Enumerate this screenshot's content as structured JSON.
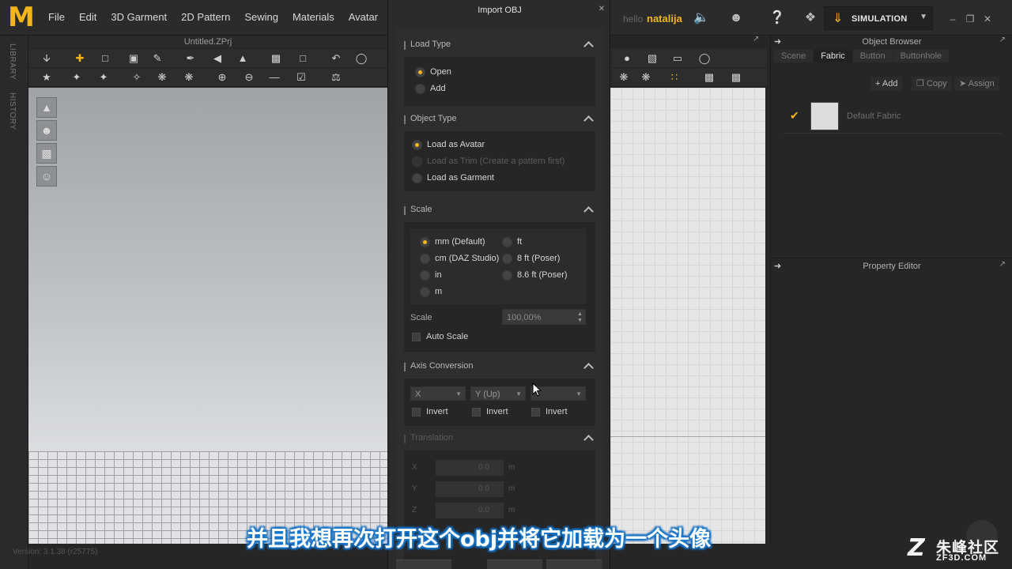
{
  "app": {
    "logo": "M",
    "menu": [
      "File",
      "Edit",
      "3D Garment",
      "2D Pattern",
      "Sewing",
      "Materials",
      "Avatar"
    ],
    "hello": "hello",
    "username": "natalija",
    "simulation_label": "SIMULATION",
    "accent_color": "#f2b61c"
  },
  "left_tabs": [
    "LIBRARY",
    "HISTORY"
  ],
  "window3d": {
    "title": "Untitled.ZPrj",
    "version": "Version: 3.1.38 (r25775)"
  },
  "object_browser": {
    "title": "Object Browser",
    "tabs": [
      "Scene",
      "Fabric",
      "Button",
      "Buttonhole"
    ],
    "active_tab": "Fabric",
    "buttons": {
      "add": "Add",
      "copy": "Copy",
      "assign": "Assign"
    },
    "fabrics": [
      {
        "name": "Default Fabric",
        "checked": true
      }
    ]
  },
  "property_editor": {
    "title": "Property Editor"
  },
  "dialog": {
    "title": "Import OBJ",
    "load_type": {
      "title": "Load Type",
      "options": [
        {
          "label": "Open",
          "selected": true
        },
        {
          "label": "Add",
          "selected": false
        }
      ]
    },
    "object_type": {
      "title": "Object Type",
      "options": [
        {
          "label": "Load as Avatar",
          "selected": true,
          "enabled": true
        },
        {
          "label": "Load as Trim (Create a pattern first)",
          "selected": false,
          "enabled": false
        },
        {
          "label": "Load as Garment",
          "selected": false,
          "enabled": true
        }
      ]
    },
    "scale": {
      "title": "Scale",
      "options_left": [
        {
          "label": "mm (Default)",
          "selected": true
        },
        {
          "label": "cm (DAZ Studio)",
          "selected": false
        },
        {
          "label": "in",
          "selected": false
        },
        {
          "label": "m",
          "selected": false
        }
      ],
      "options_right": [
        {
          "label": "ft",
          "selected": false
        },
        {
          "label": "8 ft (Poser)",
          "selected": false
        },
        {
          "label": "8.6 ft (Poser)",
          "selected": false
        }
      ],
      "scale_label": "Scale",
      "scale_value": "100,00%",
      "auto_scale_label": "Auto Scale"
    },
    "axis_conversion": {
      "title": "Axis Conversion",
      "axes": [
        "X",
        "Y (Up)",
        ""
      ],
      "invert_label": "Invert"
    },
    "translation": {
      "title": "Translation",
      "rows": [
        {
          "axis": "X",
          "value": "0.0",
          "unit": "m"
        },
        {
          "axis": "Y",
          "value": "0.0",
          "unit": "m"
        },
        {
          "axis": "Z",
          "value": "0.0",
          "unit": "m"
        }
      ]
    }
  },
  "subtitle": "并且我想再次打开这个obj并将它加载为一个头像",
  "watermark": {
    "mark": "Z",
    "name": "朱峰社区",
    "url": "ZF3D.COM"
  }
}
